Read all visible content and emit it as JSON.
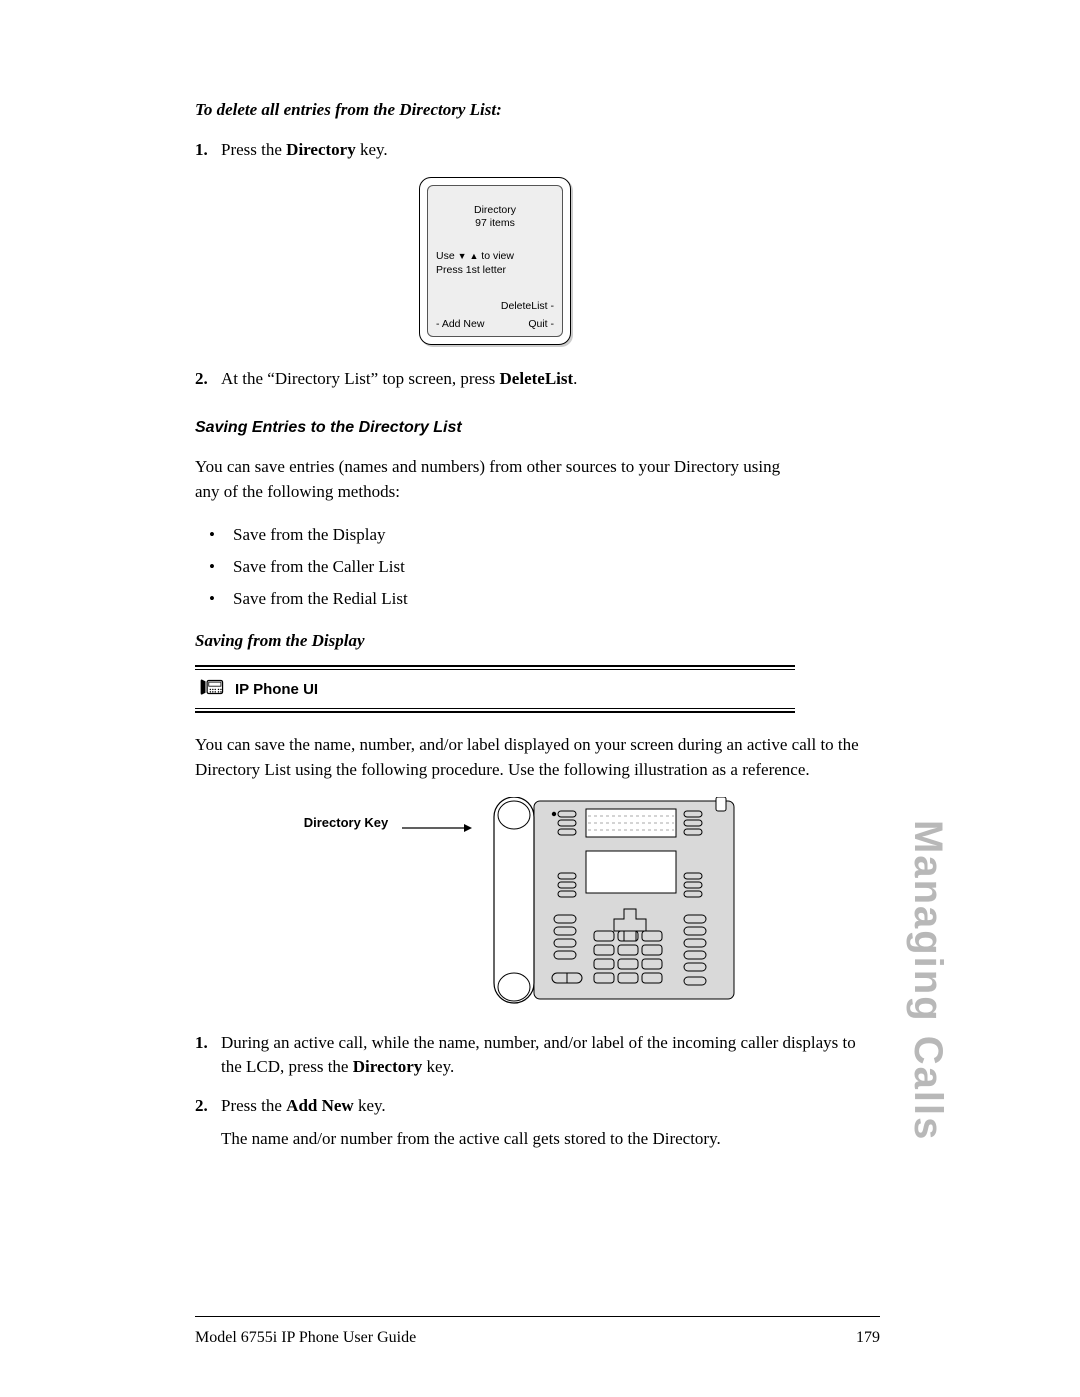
{
  "heading_delete_all": "To delete all entries from the Directory List:",
  "steps_a": {
    "1": {
      "pre": "Press the ",
      "bold": "Directory",
      "post": " key."
    },
    "2": {
      "pre": "At the “Directory List” top screen, press ",
      "bold": "DeleteList",
      "post": "."
    }
  },
  "lcd": {
    "title": "Directory",
    "count": "97 items",
    "use_pre": "Use ",
    "use_post": " to view",
    "press": "Press 1st letter",
    "deletelist": "DeleteList -",
    "addnew": "- Add New",
    "quit": "Quit -"
  },
  "section_saving_entries": "Saving Entries to the Directory List",
  "saving_intro": "You can save entries (names and numbers) from other sources to your Directory using any of the following methods:",
  "bullets": [
    "Save from the Display",
    "Save from the Caller List",
    "Save from the Redial List"
  ],
  "sub_saving_display": "Saving from the Display",
  "ipbar_label": "IP Phone UI",
  "saving_display_intro": "You can save the name, number, and/or label displayed on your screen during an active call to the Directory List using the following procedure. Use the following illustration as a reference.",
  "directory_key_label": "Directory Key",
  "steps_b": {
    "1": {
      "pre": "During an active call, while the name, number, and/or label of the incoming caller displays to the LCD, press the ",
      "bold": "Directory",
      "post": " key."
    },
    "2": {
      "pre": "Press the ",
      "bold": "Add New",
      "post": " key."
    },
    "2_sub": "The name and/or number from the active call gets stored to the Directory."
  },
  "footer_left": "Model 6755i IP Phone User Guide",
  "footer_right": "179",
  "side_tab": "Managing Calls"
}
